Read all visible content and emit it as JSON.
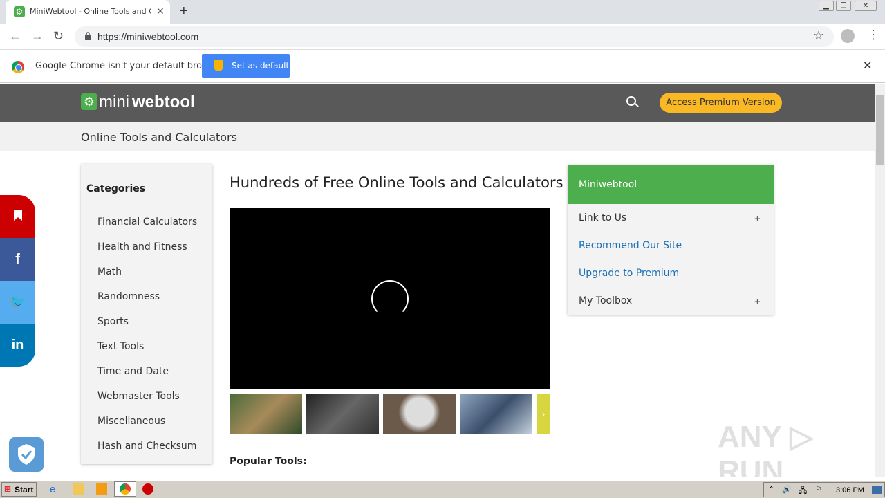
{
  "browser": {
    "tab_title": "MiniWebtool - Online Tools and Calculators",
    "url": "https://miniwebtool.com",
    "infobar_text": "Google Chrome isn't your default browser",
    "infobar_button": "Set as default"
  },
  "site": {
    "logo_mini": "mini",
    "logo_webtool": "webtool",
    "premium_button": "Access Premium Version",
    "subheader": "Online Tools and Calculators",
    "categories_title": "Categories",
    "categories": [
      "Financial Calculators",
      "Health and Fitness",
      "Math",
      "Randomness",
      "Sports",
      "Text Tools",
      "Time and Date",
      "Webmaster Tools",
      "Miscellaneous",
      "Hash and Checksum"
    ],
    "main_title": "Hundreds of Free Online Tools and Calculators",
    "popular_title": "Popular Tools:",
    "sidebar_title": "Miniwebtool",
    "sidebar_items": [
      {
        "label": "Link to Us",
        "plus": "+",
        "color": "#333333"
      },
      {
        "label": "Recommend Our Site",
        "plus": "",
        "color": "#1a6fb5"
      },
      {
        "label": "Upgrade to Premium",
        "plus": "",
        "color": "#1a6fb5"
      },
      {
        "label": "My Toolbox",
        "plus": "+",
        "color": "#333333"
      }
    ]
  },
  "taskbar": {
    "start_label": "Start",
    "clock": "3:06 PM"
  },
  "colors": {
    "header_bg": "#595959",
    "accent_green": "#4cae4c",
    "premium_yellow": "#f9b824"
  }
}
